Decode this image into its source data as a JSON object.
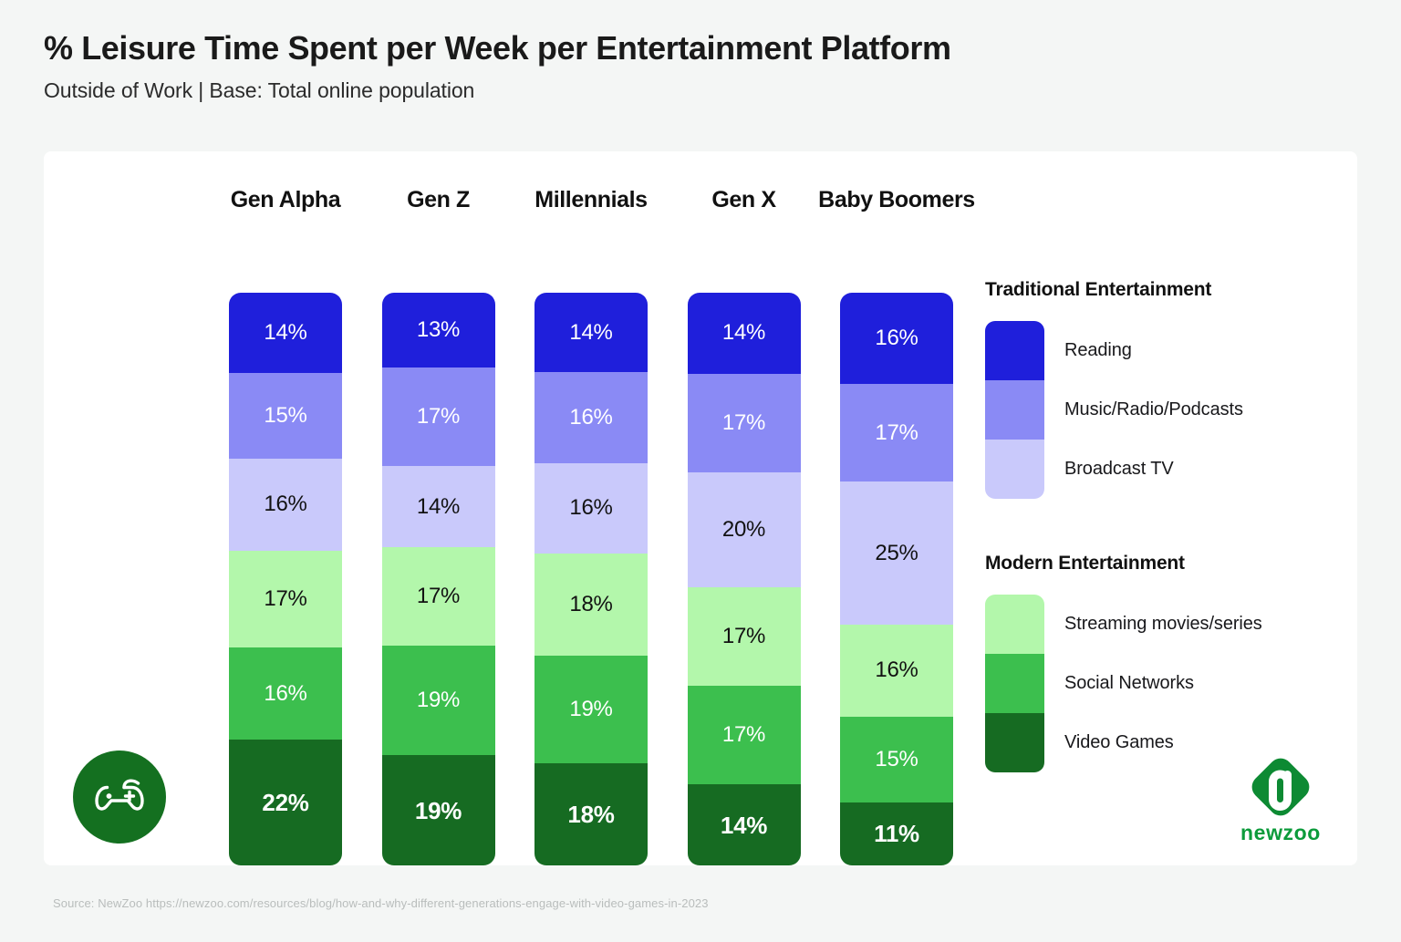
{
  "header": {
    "title": "% Leisure Time Spent per Week per Entertainment Platform",
    "subtitle": "Outside of Work |  Base: Total online population"
  },
  "source": "Source: NewZoo https://newzoo.com/resources/blog/how-and-why-different-generations-engage-with-video-games-in-2023",
  "logo": {
    "word": "newzoo"
  },
  "icons": {
    "gamepad": "gamepad-icon",
    "logo_mark": "newzoo-logo-icon"
  },
  "legend": {
    "groups": [
      {
        "title": "Traditional Entertainment",
        "items": [
          {
            "label": "Reading",
            "color": "#1f1fdb"
          },
          {
            "label": "Music/Radio/Podcasts",
            "color": "#8a8af5"
          },
          {
            "label": "Broadcast TV",
            "color": "#c9c9fb"
          }
        ]
      },
      {
        "title": "Modern Entertainment",
        "items": [
          {
            "label": "Streaming movies/series",
            "color": "#b3f7ab"
          },
          {
            "label": "Social Networks",
            "color": "#3cbf4e"
          },
          {
            "label": "Video Games",
            "color": "#166b22"
          }
        ]
      }
    ]
  },
  "chart_data": {
    "type": "bar",
    "stacked": true,
    "title": "% Leisure Time Spent per Week per Entertainment Platform",
    "subtitle": "Outside of Work |  Base: Total online population",
    "xlabel": "",
    "ylabel": "",
    "ylim": [
      0,
      100
    ],
    "unit": "%",
    "grid": false,
    "legend_position": "right",
    "categories": [
      "Gen Alpha",
      "Gen Z",
      "Millennials",
      "Gen X",
      "Baby Boomers"
    ],
    "series": [
      {
        "name": "Reading",
        "color": "#1f1fdb",
        "values": [
          14,
          13,
          14,
          14,
          16
        ]
      },
      {
        "name": "Music/Radio/Podcasts",
        "color": "#8a8af5",
        "values": [
          15,
          17,
          16,
          17,
          17
        ]
      },
      {
        "name": "Broadcast TV",
        "color": "#c9c9fb",
        "values": [
          16,
          14,
          16,
          20,
          25
        ]
      },
      {
        "name": "Streaming movies/series",
        "color": "#b3f7ab",
        "values": [
          17,
          17,
          18,
          17,
          16
        ]
      },
      {
        "name": "Social Networks",
        "color": "#3cbf4e",
        "values": [
          16,
          19,
          19,
          17,
          15
        ]
      },
      {
        "name": "Video Games",
        "color": "#166b22",
        "values": [
          22,
          19,
          18,
          14,
          11
        ]
      }
    ],
    "data_labels": [
      [
        "14%",
        "15%",
        "16%",
        "17%",
        "16%",
        "22%"
      ],
      [
        "13%",
        "17%",
        "14%",
        "17%",
        "19%",
        "19%"
      ],
      [
        "14%",
        "16%",
        "16%",
        "18%",
        "19%",
        "18%"
      ],
      [
        "14%",
        "17%",
        "20%",
        "17%",
        "17%",
        "14%"
      ],
      [
        "16%",
        "17%",
        "25%",
        "16%",
        "15%",
        "11%"
      ]
    ]
  }
}
